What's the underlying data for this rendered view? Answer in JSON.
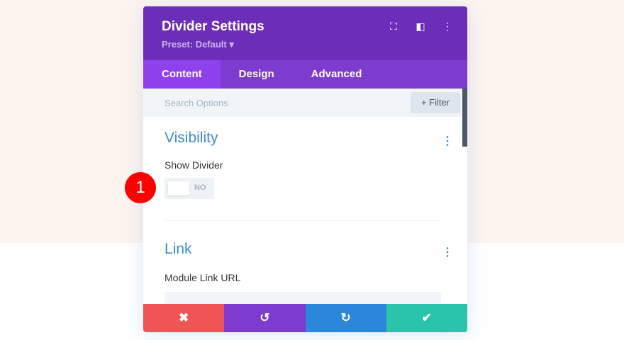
{
  "header": {
    "title": "Divider Settings",
    "preset": "Preset: Default ▾"
  },
  "tabs": [
    {
      "label": "Content"
    },
    {
      "label": "Design"
    },
    {
      "label": "Advanced"
    }
  ],
  "search": {
    "placeholder": "Search Options",
    "filter_label": "+ Filter"
  },
  "visibility": {
    "title": "Visibility",
    "show_divider_label": "Show Divider",
    "toggle_value": "NO"
  },
  "link": {
    "title": "Link",
    "url_label": "Module Link URL",
    "url_value": ""
  },
  "badge": "1",
  "colors": {
    "header": "#6c2eb9",
    "tabs": "#7e3bd0",
    "cancel": "#ef5555",
    "undo": "#7e3bd0",
    "redo": "#2b87da",
    "save": "#29c4a9"
  }
}
